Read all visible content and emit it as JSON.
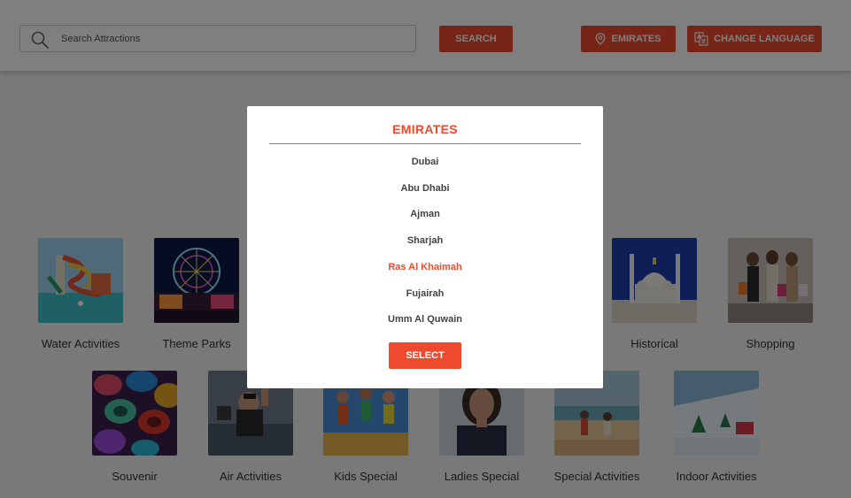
{
  "header": {
    "search_placeholder": "Search Attractions",
    "search_label": "SEARCH",
    "emirates_label": "EMIRATES",
    "language_label": "CHANGE LANGUAGE"
  },
  "categories": [
    {
      "label": "Water Activities",
      "icon": "water-slide-image"
    },
    {
      "label": "Theme Parks",
      "icon": "ferris-wheel-image"
    },
    {
      "label": "Historical",
      "icon": "mosque-image"
    },
    {
      "label": "Shopping",
      "icon": "shopping-bags-image"
    },
    {
      "label": "Souvenir",
      "icon": "souvenir-bowls-image"
    },
    {
      "label": "Air Activities",
      "icon": "skydiving-image"
    },
    {
      "label": "Kids Special",
      "icon": "kids-jumping-image"
    },
    {
      "label": "Ladies Special",
      "icon": "woman-portrait-image"
    },
    {
      "label": "Special Activities",
      "icon": "beach-running-image"
    },
    {
      "label": "Indoor Activities",
      "icon": "indoor-ski-image"
    }
  ],
  "modal": {
    "title": "EMIRATES",
    "options": [
      "Dubai",
      "Abu Dhabi",
      "Ajman",
      "Sharjah",
      "Ras Al Khaimah",
      "Fujairah",
      "Umm Al Quwain"
    ],
    "selected": "Ras Al Khaimah",
    "select_label": "SELECT"
  },
  "colors": {
    "accent": "#ee4a2e",
    "overlay": "rgba(0,0,0,0.5)"
  }
}
